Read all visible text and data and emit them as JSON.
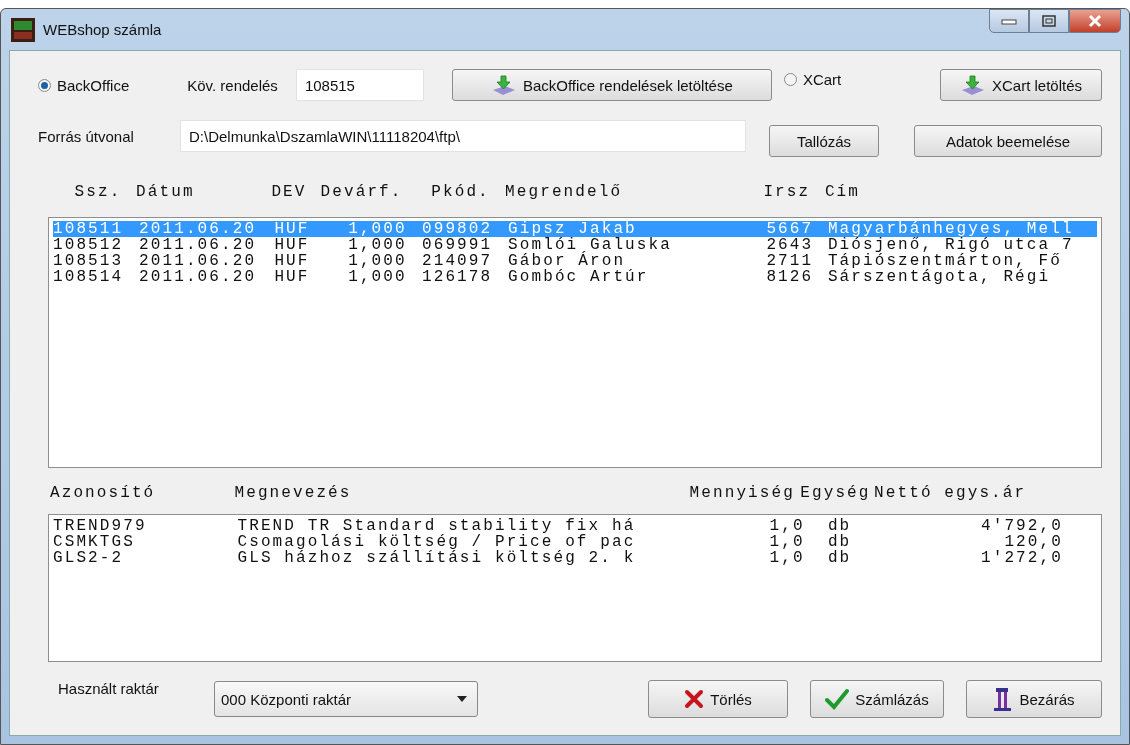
{
  "window": {
    "title": "WEBshop számla"
  },
  "backoffice_radio": {
    "label": "BackOffice",
    "selected": true
  },
  "next_order": {
    "label": "Köv. rendelés",
    "value": "108515"
  },
  "backoffice_download_button": "BackOffice rendelések letöltése",
  "xcart_radio": {
    "label": "XCart",
    "selected": false
  },
  "xcart_download_button": "XCart letöltés",
  "source_path": {
    "label": "Forrás útvonal",
    "value": "D:\\Delmunka\\DszamlaWIN\\11118204\\ftp\\"
  },
  "browse_button": "Tallózás",
  "import_button": "Adatok beemelése",
  "orders": {
    "columns": [
      "Ssz.",
      "Dátum",
      "DEV",
      "Devárf.",
      "Pkód.",
      "Megrendelő",
      "Irsz",
      "Cím"
    ],
    "rows": [
      {
        "cells": [
          "108511",
          "2011.06.20",
          "HUF",
          "1,000",
          "099802",
          "Gipsz Jakab",
          "5667",
          "Magyarbánhegyes, Mell"
        ],
        "selected": true
      },
      {
        "cells": [
          "108512",
          "2011.06.20",
          "HUF",
          "1,000",
          "069991",
          "Somlói Galuska",
          "2643",
          "Diósjenő, Rigó utca 7"
        ],
        "selected": false
      },
      {
        "cells": [
          "108513",
          "2011.06.20",
          "HUF",
          "1,000",
          "214097",
          "Gábor Áron",
          "2711",
          "Tápiószentmárton, Fő"
        ],
        "selected": false
      },
      {
        "cells": [
          "108514",
          "2011.06.20",
          "HUF",
          "1,000",
          "126178",
          "Gombóc Artúr",
          "8126",
          "Sárszentágota, Régi"
        ],
        "selected": false
      }
    ]
  },
  "items": {
    "columns": [
      "Azonosító",
      "Megnevezés",
      "Mennyiség",
      "Egység",
      "Nettó egys.ár"
    ],
    "rows": [
      {
        "cells": [
          "TREND979",
          "TREND TR Standard stability fix há",
          "1,0",
          "db",
          "4'792,0"
        ]
      },
      {
        "cells": [
          "CSMKTGS",
          "Csomagolási költség / Price of pac",
          "1,0",
          "db",
          "120,0"
        ]
      },
      {
        "cells": [
          "GLS2-2",
          "GLS házhoz szállítási költség 2. k",
          "1,0",
          "db",
          "1'272,0"
        ]
      }
    ]
  },
  "warehouse": {
    "label": "Használt raktár",
    "value": "000 Központi raktár"
  },
  "buttons": [
    {
      "kind": "delete",
      "label": "Törlés"
    },
    {
      "kind": "invoice",
      "label": "Számlázás"
    },
    {
      "kind": "close",
      "label": "Bezárás"
    }
  ]
}
